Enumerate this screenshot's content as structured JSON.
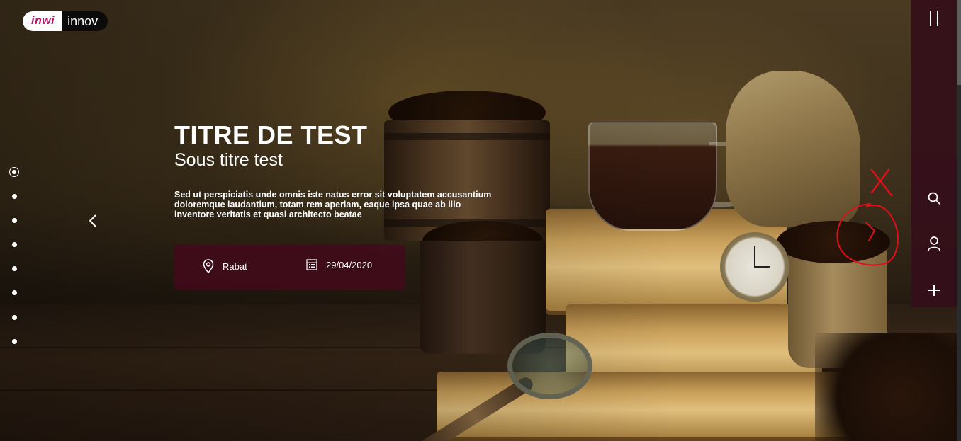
{
  "logo": {
    "left_text": "inwi",
    "right_text": "innov",
    "brand_color": "#b3166b"
  },
  "hero": {
    "title": "TITRE DE TEST",
    "subtitle": "Sous titre test",
    "description": "Sed ut perspiciatis unde omnis iste natus error sit voluptatem accusantium doloremque laudantium, totam rem aperiam, eaque ipsa quae ab illo inventore veritatis et quasi architecto beatae"
  },
  "info": {
    "location_icon": "location-pin-icon",
    "location": "Rabat",
    "date_icon": "calendar-icon",
    "date": "29/04/2020"
  },
  "pager": {
    "total_slides": 8,
    "active_index": 0
  },
  "sidebar": {
    "menu_icon": "menu-toggle-icon",
    "icons": [
      "search-icon",
      "user-icon",
      "plus-icon"
    ],
    "background": "#340e1a"
  },
  "colors": {
    "info_box_background": "#420a1a",
    "annotation_red": "#e0101a"
  }
}
